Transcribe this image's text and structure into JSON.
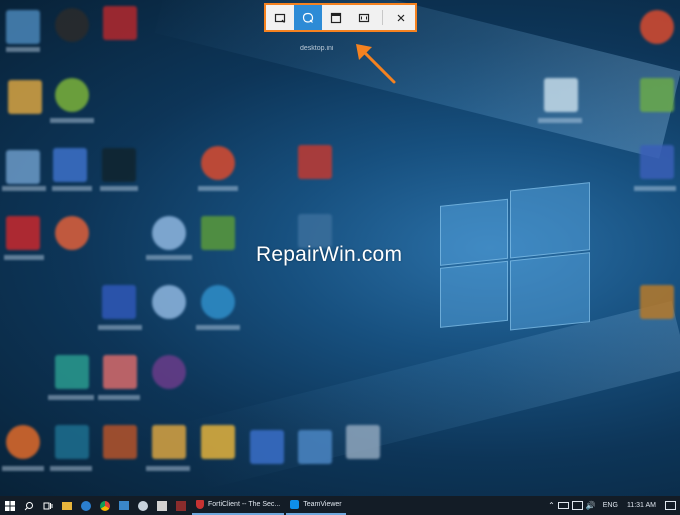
{
  "snip_toolbar": {
    "buttons": [
      {
        "name": "rectangular-snip",
        "icon": "rectangle-snip-icon",
        "active": false
      },
      {
        "name": "freeform-snip",
        "icon": "freeform-snip-icon",
        "active": true
      },
      {
        "name": "window-snip",
        "icon": "window-snip-icon",
        "active": false
      },
      {
        "name": "fullscreen-snip",
        "icon": "fullscreen-snip-icon",
        "active": false
      },
      {
        "name": "close",
        "icon": "close-icon",
        "active": false
      }
    ],
    "highlight_color": "#f58220",
    "active_color": "#2d8bd6"
  },
  "desktop": {
    "watermark": "RepairWin.com",
    "icon_caption": "desktop.ini"
  },
  "taskbar": {
    "apps": [
      {
        "label": "FortiClient -- The Sec...",
        "icon": "forticlient-icon"
      },
      {
        "label": "TeamViewer",
        "icon": "teamviewer-icon"
      }
    ],
    "language": "ENG",
    "time": "11:31 AM"
  }
}
